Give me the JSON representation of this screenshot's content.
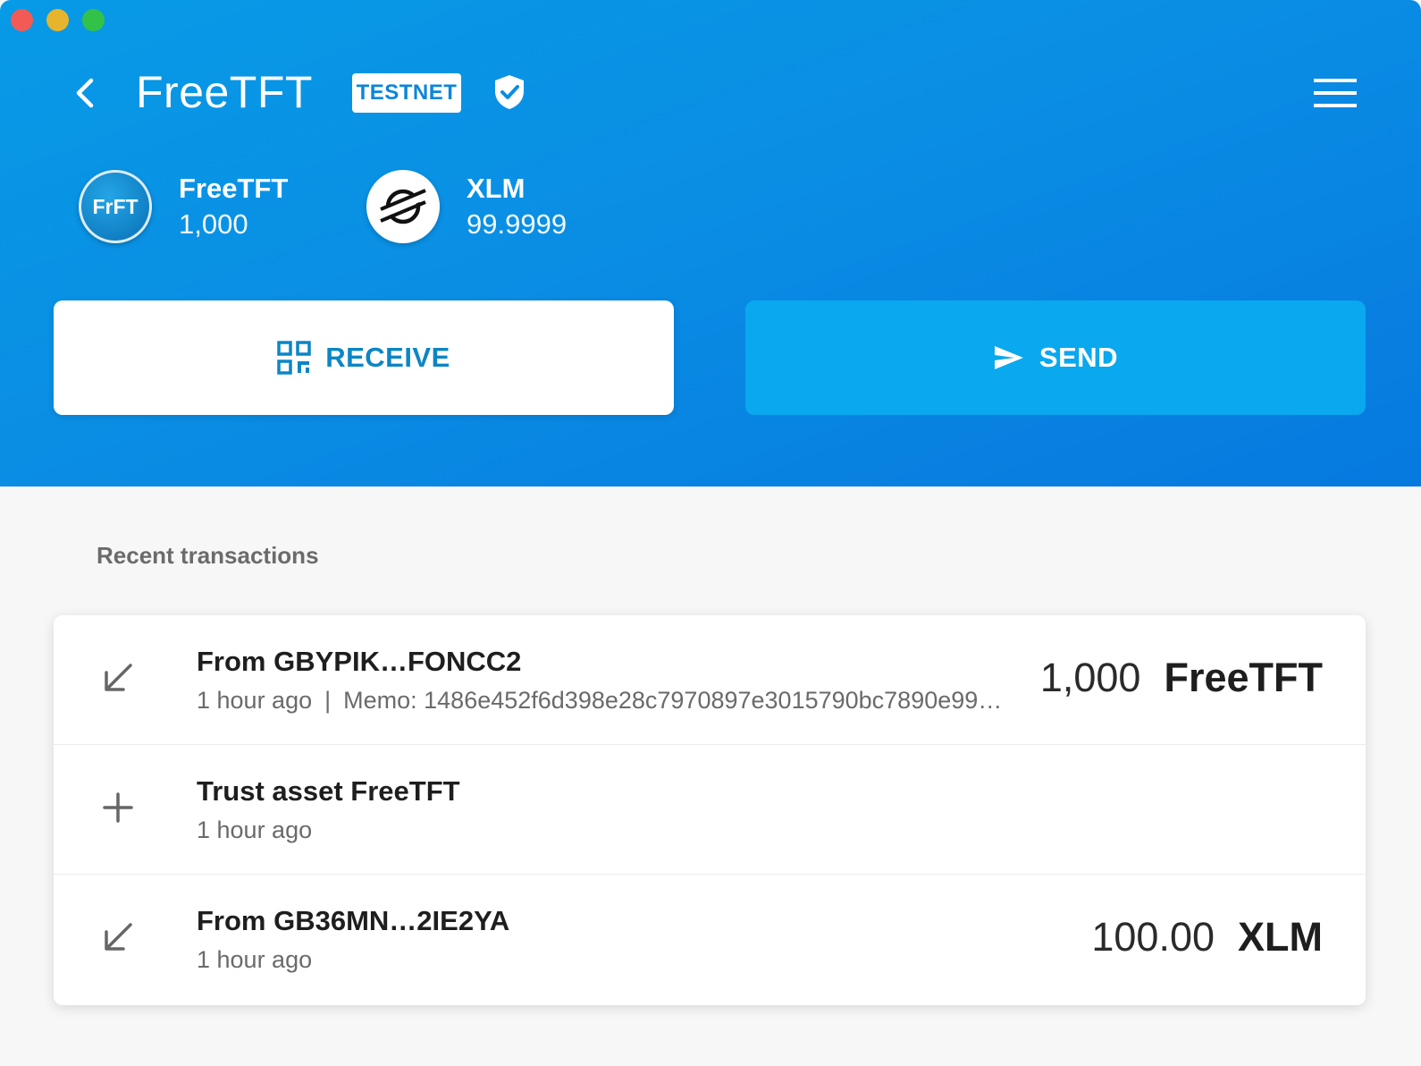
{
  "header": {
    "title": "FreeTFT",
    "network_badge": "TESTNET"
  },
  "balances": [
    {
      "code_icon": "FrFT",
      "name": "FreeTFT",
      "amount": "1,000"
    },
    {
      "name": "XLM",
      "amount": "99.9999"
    }
  ],
  "actions": {
    "receive_label": "RECEIVE",
    "send_label": "SEND"
  },
  "transactions": {
    "section_title": "Recent transactions",
    "items": [
      {
        "title": "From GBYPIK…FONCC2",
        "time": "1 hour ago",
        "separator": "|",
        "memo": "Memo: 1486e452f6d398e28c7970897e3015790bc7890e99…",
        "amount": "1,000",
        "currency": "FreeTFT",
        "icon": "arrow-down-left-icon"
      },
      {
        "title": "Trust asset FreeTFT",
        "time": "1 hour ago",
        "icon": "plus-icon"
      },
      {
        "title": "From GB36MN…2IE2YA",
        "time": "1 hour ago",
        "amount": "100.00",
        "currency": "XLM",
        "icon": "arrow-down-left-icon"
      }
    ]
  },
  "colors": {
    "header_blue": "#0a8ee4",
    "send_button": "#0aa8ee",
    "receive_text": "#0b86c5"
  }
}
